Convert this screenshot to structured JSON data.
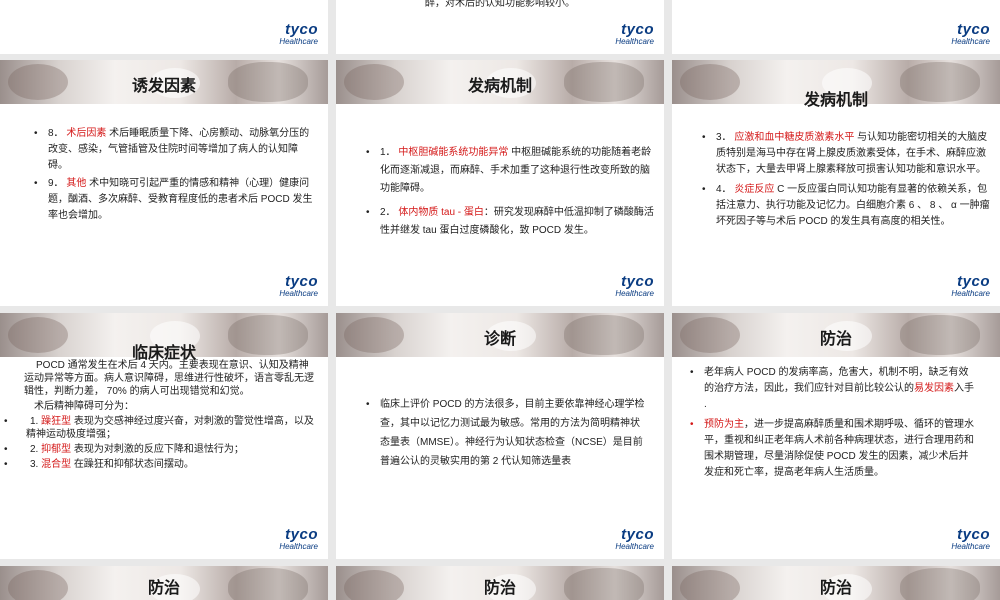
{
  "logo": {
    "brand": "tyco",
    "sub": "Healthcare"
  },
  "slides": {
    "s0": {},
    "s1": {
      "text": "醉，对术后的认知功能影响较小。"
    },
    "s2": {},
    "s3": {
      "title": "诱发因素",
      "items": [
        {
          "num": "8．",
          "key": "术后因素",
          "text": "术后睡眠质量下降、心房颤动、动脉氧分压的改变、感染，气管插管及住院时间等增加了病人的认知障碍。"
        },
        {
          "num": "9．",
          "key": "其他",
          "text": "术中知晓可引起严重的情感和精神（心理）健康问题，酗酒、多次麻醉、受教育程度低的患者术后 POCD 发生率也会增加。"
        }
      ]
    },
    "s4": {
      "title": "发病机制",
      "items": [
        {
          "num": "1．",
          "key": "中枢胆碱能系统功能异常",
          "text": "中枢胆碱能系统的功能随着老龄化而逐渐减退，而麻醉、手术加重了这种退行性改变所致的脑功能障碍。"
        },
        {
          "num": "2．",
          "key": "体内物质 tau - 蛋白",
          "text": "：研究发现麻醉中低温抑制了磷酸酶活性并继发 tau 蛋白过度磷酸化，致 POCD 发生。"
        }
      ]
    },
    "s5": {
      "title": "发病机制",
      "items": [
        {
          "num": "3．",
          "key": "应激和血中糖皮质激素水平",
          "text": "与认知功能密切相关的大脑皮质特别是海马中存在肾上腺皮质激素受体，在手术、麻醉应激状态下，大量去甲肾上腺素释放可损害认知功能和意识水平。"
        },
        {
          "num": "4．",
          "key": "炎症反应",
          "text": "C 一反应蛋白同认知功能有显著的依赖关系，包括注意力、执行功能及记忆力。白细胞介素 6 、 8 、 α 一肿瘤坏死因子等与术后 POCD 的发生具有高度的相关性。"
        }
      ]
    },
    "s6": {
      "title": "临床症状",
      "intro": "POCD 通常发生在术后 4 天内。主要表现在意识、认知及精神运动异常等方面。病人意识障碍，思维进行性破坏，语言零乱无逻辑性，判断力差， 70% 的病人可出现错觉和幻觉。",
      "sub": "术后精神障碍可分为：",
      "items": [
        {
          "num": "1.",
          "key": "躁狂型",
          "text": "表现为交感神经过度兴奋，对刺激的警觉性增高，以及精神运动极度增强；"
        },
        {
          "num": "2.",
          "key": "抑郁型",
          "text": "表现为对刺激的反应下降和退怯行为；"
        },
        {
          "num": "3.",
          "key": "混合型",
          "text": "在躁狂和抑郁状态间摆动。"
        }
      ]
    },
    "s7": {
      "title": "诊断",
      "items": [
        {
          "text": "临床上评价 POCD 的方法很多，目前主要依靠神经心理学检查，其中以记忆力测试最为敏感。常用的方法为简明精神状态量表（MMSE）。神经行为认知状态检查（NCSE）是目前普遍公认的灵敏实用的第 2 代认知筛选量表"
        }
      ]
    },
    "s8": {
      "title": "防治",
      "item1_pre": "老年病人 POCD 的发病率高，危害大，机制不明，缺乏有效的治疗方法，因此，我们应针对目前比较公认的",
      "item1_key": "易发因素",
      "item1_post": "入手 .",
      "item2_key": "预防为主",
      "item2_text": "，进一步提高麻醉质量和围术期呼吸、循环的管理水平，重视和纠正老年病人术前各种病理状态，进行合理用药和围术期管理，尽量消除促使 POCD 发生的因素，减少术后并发症和死亡率，提高老年病人生活质量。"
    },
    "s9": {
      "title": "防治"
    },
    "s10": {
      "title": "防治"
    },
    "s11": {
      "title": "防治"
    }
  }
}
